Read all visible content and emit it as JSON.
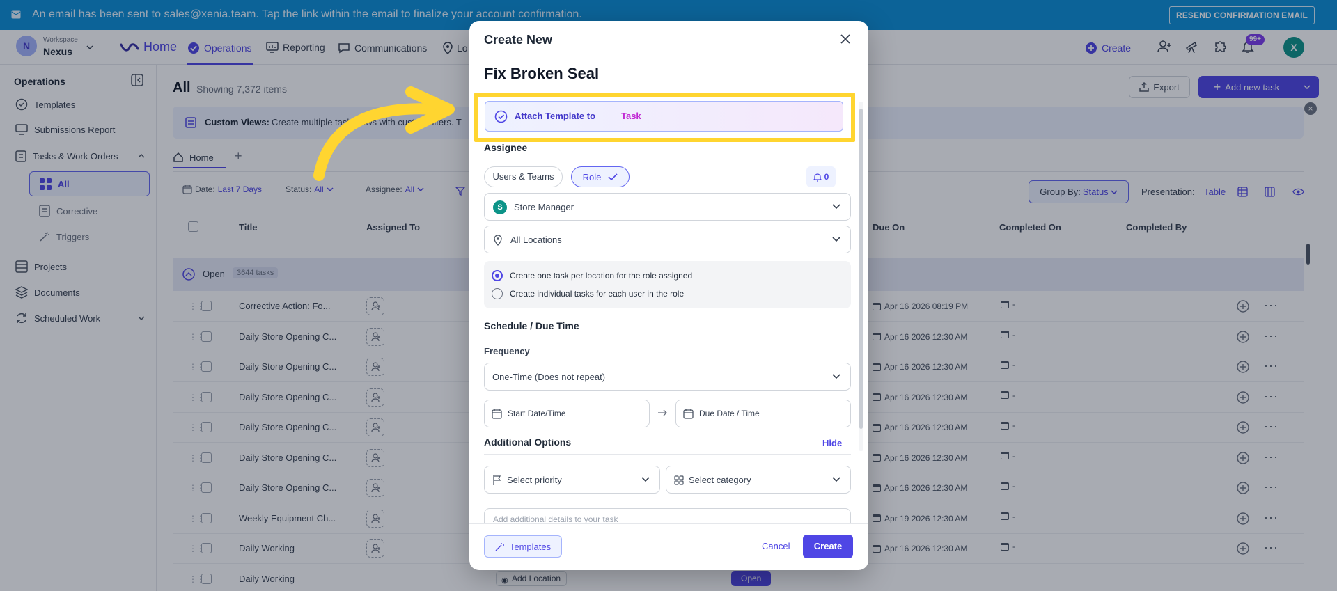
{
  "banner": {
    "message": "An email has been sent to sales@xenia.team. Tap the link within the email to finalize your account confirmation.",
    "resend_label": "RESEND CONFIRMATION EMAIL"
  },
  "workspace": {
    "initial": "N",
    "label": "Workspace",
    "name": "Nexus"
  },
  "nav": {
    "home": "Home",
    "operations": "Operations",
    "reporting": "Reporting",
    "communications": "Communications",
    "locations": "Lo",
    "create": "Create",
    "notif_badge": "99+",
    "user_initial": "X"
  },
  "sidebar": {
    "heading": "Operations",
    "templates": "Templates",
    "submissions": "Submissions Report",
    "tasks": "Tasks & Work Orders",
    "all": "All",
    "corrective": "Corrective",
    "triggers": "Triggers",
    "projects": "Projects",
    "documents": "Documents",
    "scheduled": "Scheduled Work"
  },
  "main": {
    "title": "All",
    "count": "Showing 7,372 items",
    "export": "Export",
    "add_task": "Add new task",
    "custom_views_label": "Custom Views:",
    "custom_views_text": "Create multiple task views with custom filters. T",
    "tab_home": "Home",
    "filters": {
      "date_label": "Date:",
      "date_value": "Last 7 Days",
      "status_label": "Status:",
      "status_value": "All",
      "assignee_label": "Assignee:",
      "assignee_value": "All"
    },
    "group_by_label": "Group By:",
    "group_by_value": "Status",
    "presentation_label": "Presentation:",
    "presentation_value": "Table",
    "columns": {
      "title": "Title",
      "assigned": "Assigned To",
      "due": "Due On",
      "completed_on": "Completed On",
      "completed_by": "Completed By"
    },
    "group": {
      "label": "Open",
      "count": "3644 tasks"
    },
    "rows": [
      {
        "title": "Corrective Action: Fo...",
        "due": "Apr 16 2026 08:19 PM",
        "done": "-"
      },
      {
        "title": "Daily Store Opening C...",
        "due": "Apr 16 2026 12:30 AM",
        "done": "-"
      },
      {
        "title": "Daily Store Opening C...",
        "due": "Apr 16 2026 12:30 AM",
        "done": "-"
      },
      {
        "title": "Daily Store Opening C...",
        "due": "Apr 16 2026 12:30 AM",
        "done": "-"
      },
      {
        "title": "Daily Store Opening C...",
        "due": "Apr 16 2026 12:30 AM",
        "done": "-"
      },
      {
        "title": "Daily Store Opening C...",
        "due": "Apr 16 2026 12:30 AM",
        "done": "-"
      },
      {
        "title": "Daily Store Opening C...",
        "due": "Apr 16 2026 12:30 AM",
        "done": "-"
      },
      {
        "title": "Weekly Equipment Ch...",
        "due": "Apr 19 2026 12:30 AM",
        "done": "-"
      },
      {
        "title": "Daily Working",
        "due": "Apr 16 2026 12:30 AM",
        "done": "-"
      },
      {
        "title": "Daily Working",
        "due": "",
        "done": ""
      }
    ],
    "add_location": "Add Location",
    "open_status": "Open"
  },
  "modal": {
    "title": "Create New",
    "task_name": "Fix Broken Seal",
    "attach_prefix": "Attach Template to",
    "attach_suffix": "Task",
    "assignee_heading": "Assignee",
    "users_teams": "Users & Teams",
    "role": "Role",
    "notify_count": "0",
    "role_initial": "S",
    "role_value": "Store Manager",
    "location_value": "All Locations",
    "radio_one": "Create one task per location for the role assigned",
    "radio_two": "Create individual tasks for each user in the role",
    "schedule_heading": "Schedule / Due Time",
    "frequency_label": "Frequency",
    "frequency_value": "One-Time (Does not repeat)",
    "start_placeholder": "Start Date/Time",
    "due_placeholder": "Due Date / Time",
    "additional_heading": "Additional Options",
    "hide": "Hide",
    "priority_placeholder": "Select priority",
    "category_placeholder": "Select category",
    "details_placeholder": "Add additional details to your task",
    "templates_btn": "Templates",
    "cancel": "Cancel",
    "create": "Create"
  },
  "colors": {
    "accent": "#4f46e5",
    "banner": "#0b8fd6",
    "highlight": "#ffd530",
    "arrow": "#ffd530"
  }
}
